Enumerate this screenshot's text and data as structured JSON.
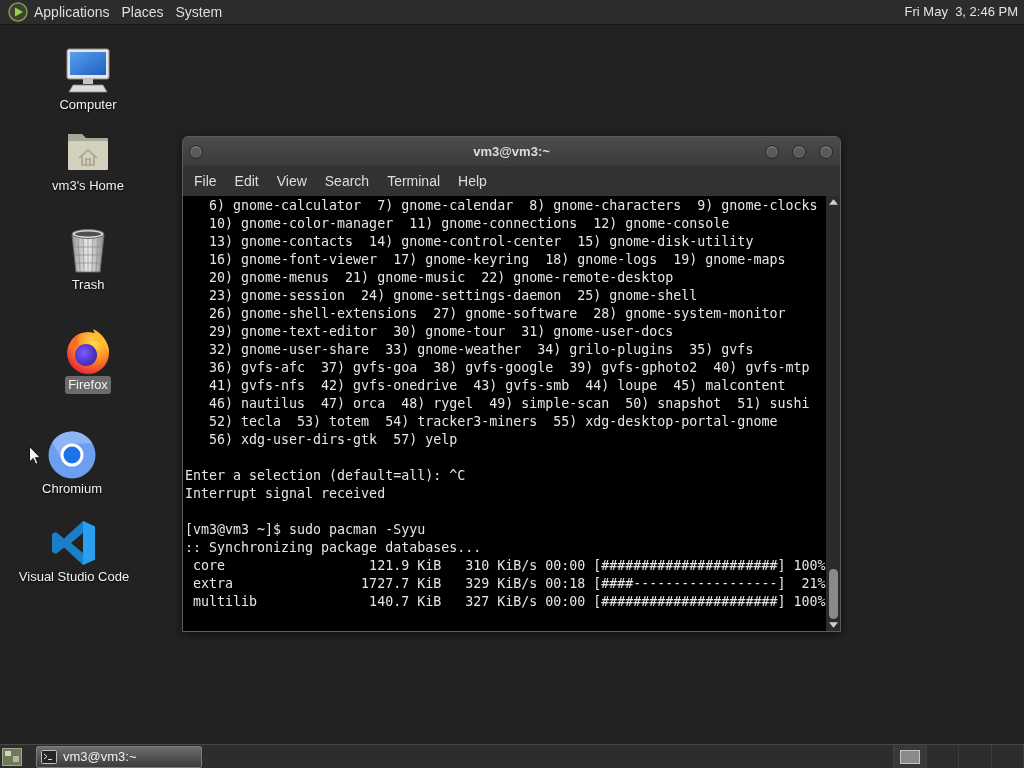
{
  "top_panel": {
    "menus": [
      {
        "label": "Applications"
      },
      {
        "label": "Places"
      },
      {
        "label": "System"
      }
    ],
    "clock": "Fri May  3, 2:46 PM"
  },
  "desktop_icons": [
    {
      "kind": "computer",
      "label": "Computer",
      "selected": false
    },
    {
      "kind": "home",
      "label": "vm3's Home",
      "selected": false
    },
    {
      "kind": "trash",
      "label": "Trash",
      "selected": false
    },
    {
      "kind": "firefox",
      "label": "Firefox",
      "selected": true
    },
    {
      "kind": "chromium",
      "label": "Chromium",
      "selected": false
    },
    {
      "kind": "vscode",
      "label": "Visual Studio Code",
      "selected": false
    }
  ],
  "terminal_window": {
    "title": "vm3@vm3:~",
    "menus": [
      "File",
      "Edit",
      "View",
      "Search",
      "Terminal",
      "Help"
    ],
    "output_blocks": [
      [
        "   6) gnome-calculator  7) gnome-calendar  8) gnome-characters  9) gnome-clocks",
        "   10) gnome-color-manager  11) gnome-connections  12) gnome-console",
        "   13) gnome-contacts  14) gnome-control-center  15) gnome-disk-utility",
        "   16) gnome-font-viewer  17) gnome-keyring  18) gnome-logs  19) gnome-maps",
        "   20) gnome-menus  21) gnome-music  22) gnome-remote-desktop",
        "   23) gnome-session  24) gnome-settings-daemon  25) gnome-shell",
        "   26) gnome-shell-extensions  27) gnome-software  28) gnome-system-monitor",
        "   29) gnome-text-editor  30) gnome-tour  31) gnome-user-docs",
        "   32) gnome-user-share  33) gnome-weather  34) grilo-plugins  35) gvfs",
        "   36) gvfs-afc  37) gvfs-goa  38) gvfs-google  39) gvfs-gphoto2  40) gvfs-mtp",
        "   41) gvfs-nfs  42) gvfs-onedrive  43) gvfs-smb  44) loupe  45) malcontent",
        "   46) nautilus  47) orca  48) rygel  49) simple-scan  50) snapshot  51) sushi",
        "   52) tecla  53) totem  54) tracker3-miners  55) xdg-desktop-portal-gnome",
        "   56) xdg-user-dirs-gtk  57) yelp"
      ],
      [
        "Enter a selection (default=all): ^C",
        "Interrupt signal received"
      ],
      [
        "[vm3@vm3 ~]$ sudo pacman -Syyu",
        ":: Synchronizing package databases...",
        " core                  121.9 KiB   310 KiB/s 00:00 [######################] 100%",
        " extra                1727.7 KiB   329 KiB/s 00:18 [####------------------]  21%",
        " multilib              140.7 KiB   327 KiB/s 00:00 [######################] 100%"
      ]
    ]
  },
  "taskbar": {
    "tasks": [
      {
        "label": "vm3@vm3:~",
        "selected": true
      }
    ]
  }
}
